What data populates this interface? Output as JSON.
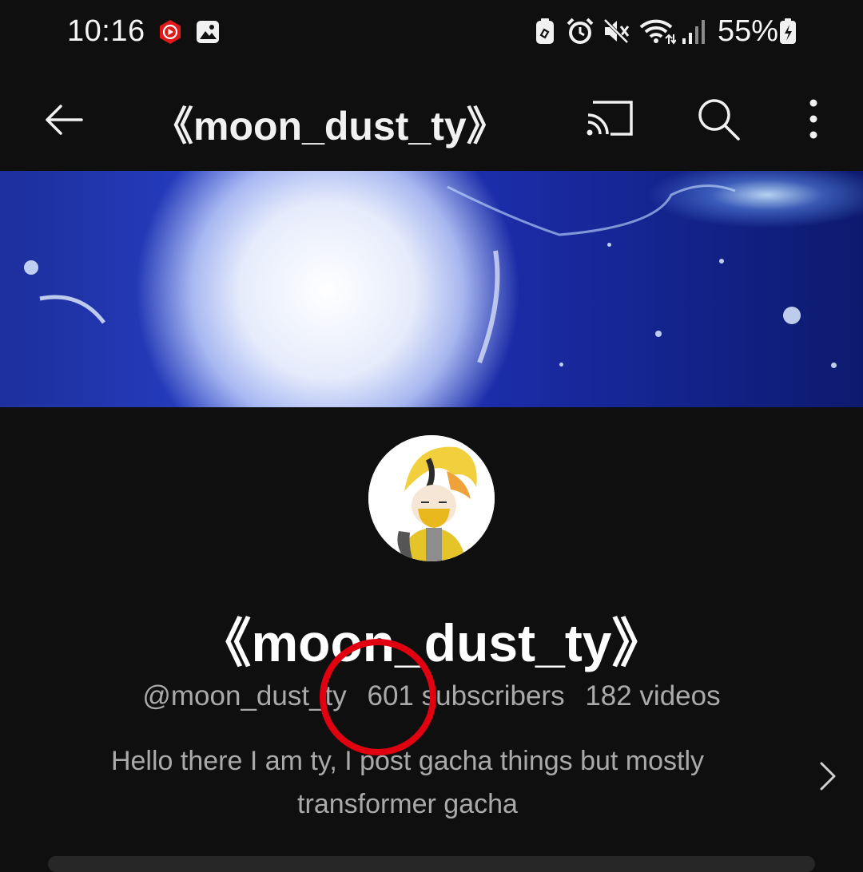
{
  "status_bar": {
    "time": "10:16",
    "battery": "55%",
    "notification_icons": [
      "youtube-notification-icon",
      "gallery-icon"
    ],
    "system_icons": [
      "battery-saver-icon",
      "alarm-icon",
      "mute-icon",
      "wifi-icon",
      "signal-icon",
      "battery-charging-icon"
    ]
  },
  "app_bar": {
    "title": "《moon_dust_ty》"
  },
  "channel": {
    "name": "《moon_dust_ty》",
    "handle": "@moon_dust_ty",
    "subscribers": "601 subscribers",
    "videos": "182 videos",
    "description": "Hello there I am ty, I post gacha things but mostly transformer gacha"
  },
  "colors": {
    "background": "#0f0f0f",
    "primary_text": "#f1f1f1",
    "secondary_text": "#aaaaaa",
    "highlight": "#e00010"
  }
}
